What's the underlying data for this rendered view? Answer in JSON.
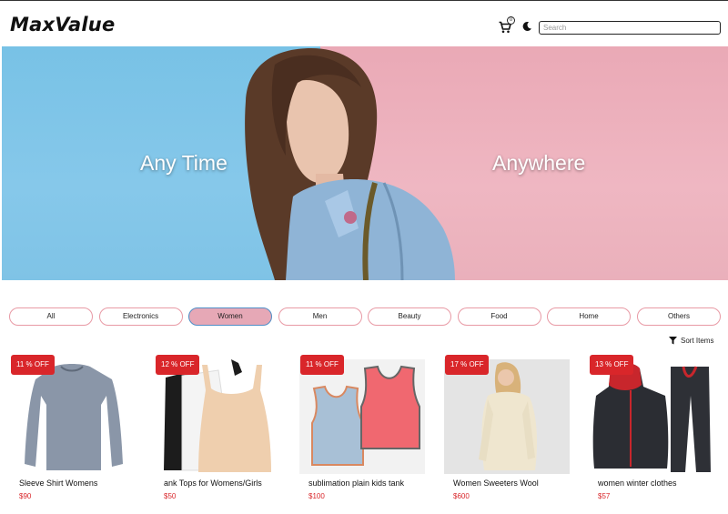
{
  "header": {
    "logo": "MaxValue",
    "cart_count": "0",
    "search_placeholder": "Search"
  },
  "hero": {
    "left_text": "Any Time",
    "right_text": "Anywhere"
  },
  "filters": [
    {
      "label": "All"
    },
    {
      "label": "Electronics"
    },
    {
      "label": "Women",
      "active": true
    },
    {
      "label": "Men"
    },
    {
      "label": "Beauty"
    },
    {
      "label": "Food"
    },
    {
      "label": "Home"
    },
    {
      "label": "Others"
    }
  ],
  "sort": {
    "label": "Sort Items"
  },
  "products": [
    {
      "badge": "11 % OFF",
      "title": "Sleeve Shirt Womens",
      "price": "$90"
    },
    {
      "badge": "12 % OFF",
      "title": "ank Tops for Womens/Girls",
      "price": "$50"
    },
    {
      "badge": "11 % OFF",
      "title": "sublimation plain kids tank",
      "price": "$100"
    },
    {
      "badge": "17 % OFF",
      "title": "Women Sweeters Wool",
      "price": "$600"
    },
    {
      "badge": "13 % OFF",
      "title": "women winter clothes",
      "price": "$57"
    }
  ],
  "colors": {
    "accent_red": "#d9262a",
    "chip_border": "#e89aa5",
    "chip_active_bg": "#e6a8b6",
    "chip_active_border": "#4f8ec7",
    "hero_blue": "#78c2e6",
    "hero_pink": "#eaa9b6"
  }
}
